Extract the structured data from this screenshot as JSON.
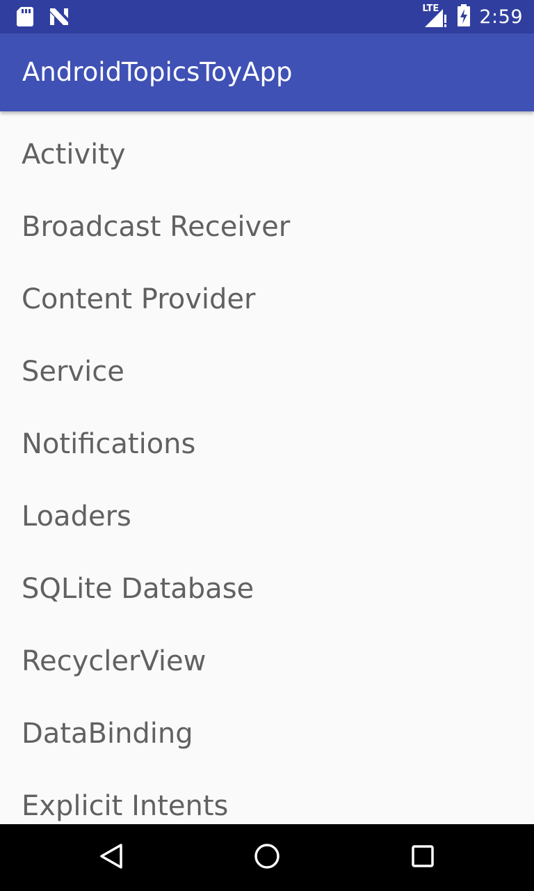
{
  "status_bar": {
    "left_icons": [
      "sd-card-icon",
      "n-notification-icon"
    ],
    "network_label": "LTE",
    "time": "2:59",
    "right_icons": [
      "signal-icon",
      "battery-charging-icon"
    ]
  },
  "app_bar": {
    "title": "AndroidTopicsToyApp"
  },
  "list": {
    "items": [
      {
        "label": "Activity"
      },
      {
        "label": "Broadcast Receiver"
      },
      {
        "label": "Content Provider"
      },
      {
        "label": "Service"
      },
      {
        "label": "Notifications"
      },
      {
        "label": "Loaders"
      },
      {
        "label": "SQLite Database"
      },
      {
        "label": "RecyclerView"
      },
      {
        "label": "DataBinding"
      },
      {
        "label": "Explicit Intents"
      }
    ]
  },
  "nav_bar": {
    "buttons": [
      "back-icon",
      "home-icon",
      "recents-icon"
    ]
  },
  "colors": {
    "status_bar": "#303f9f",
    "app_bar": "#3f51b5",
    "background": "#fafafa",
    "item_text": "#616161",
    "nav_bar": "#000000"
  }
}
